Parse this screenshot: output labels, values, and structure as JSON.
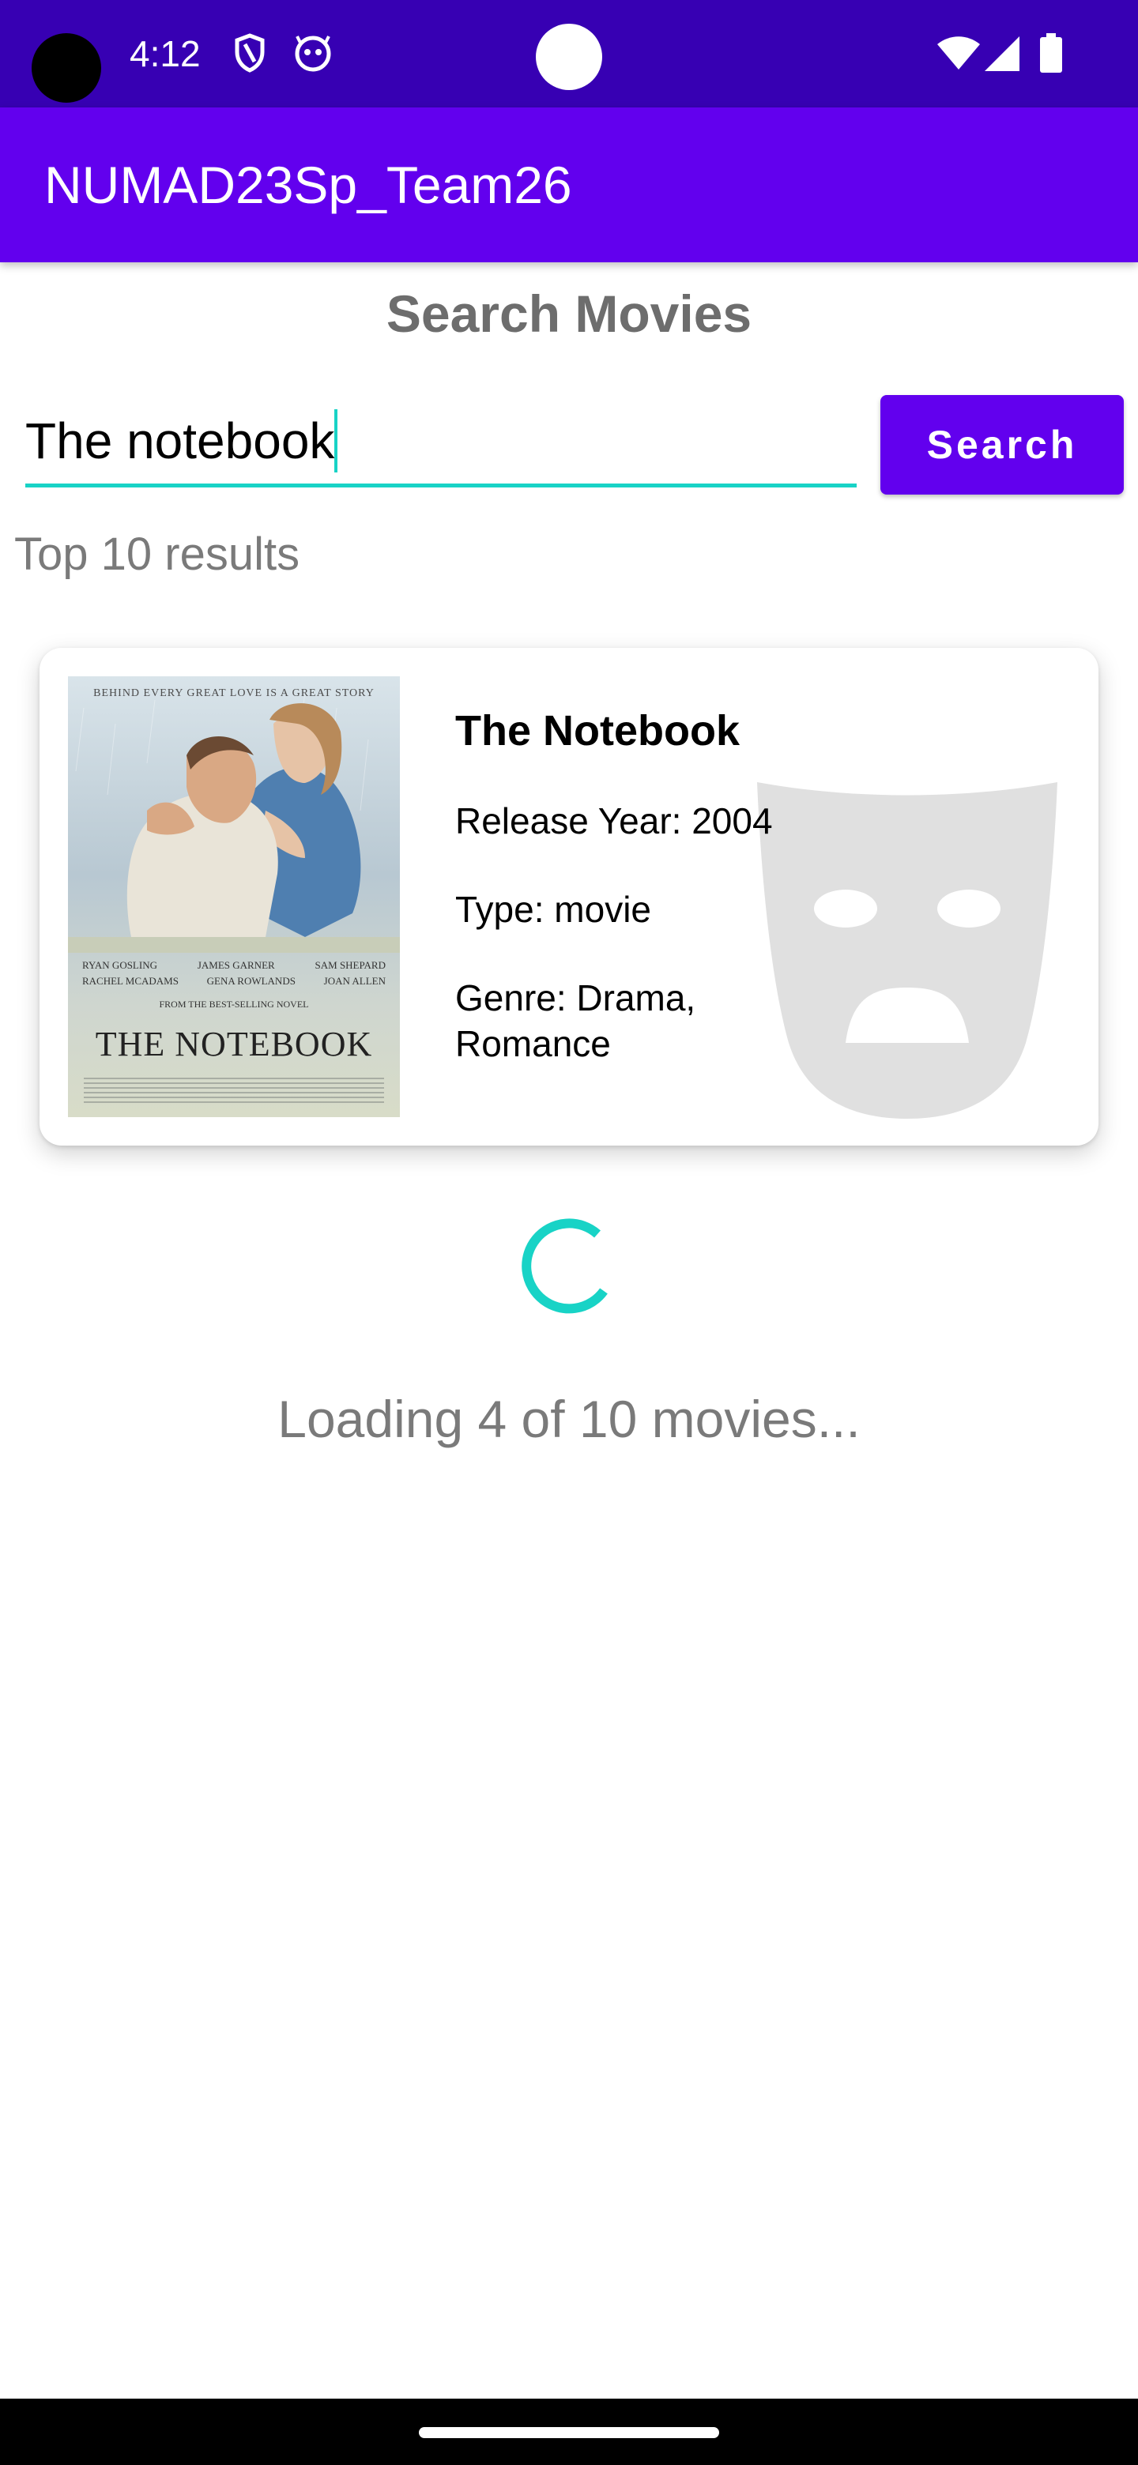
{
  "status_bar": {
    "time": "4:12",
    "icons": [
      "shield-icon",
      "android-head-icon",
      "wifi-icon",
      "signal-icon",
      "battery-icon"
    ]
  },
  "app_bar": {
    "title": "NUMAD23Sp_Team26"
  },
  "search": {
    "heading": "Search Movies",
    "query": "The notebook",
    "button_label": "Search"
  },
  "results": {
    "label": "Top 10 results",
    "items": [
      {
        "title": "The Notebook",
        "release_year": "Release Year: 2004",
        "type": "Type: movie",
        "genre": "Genre: Drama,\n Romance",
        "genre_icon": "drama-mask-icon",
        "poster": {
          "tagline": "BEHIND EVERY GREAT LOVE IS A GREAT STORY",
          "cast_row1": [
            "RYAN GOSLING",
            "JAMES GARNER",
            "SAM SHEPARD"
          ],
          "cast_row2": [
            "RACHEL MCADAMS",
            "GENA ROWLANDS",
            "JOAN ALLEN"
          ],
          "novel_line": "FROM THE BEST-SELLING NOVEL",
          "title": "THE NOTEBOOK"
        }
      }
    ]
  },
  "loading": {
    "text": "Loading 4 of 10 movies...",
    "loaded": 4,
    "total": 10
  },
  "colors": {
    "primary": "#6200EE",
    "primary_dark": "#3700B3",
    "accent": "#18D3C6",
    "heading_gray": "#6d6d6d"
  }
}
